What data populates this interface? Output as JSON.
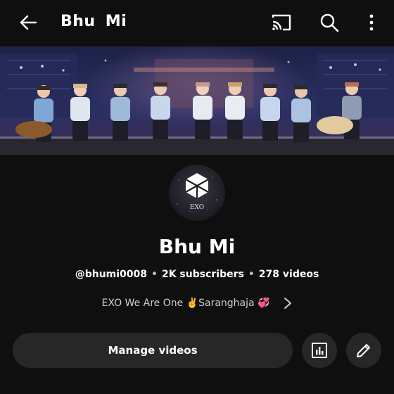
{
  "header": {
    "title": "Bhu  Mi",
    "icons": [
      "back-arrow-icon",
      "cast-icon",
      "search-icon",
      "more-vert-icon"
    ]
  },
  "channel": {
    "name": "Bhu Mi",
    "handle": "@bhumi0008",
    "subscribers": "2K subscribers",
    "videos": "278 videos",
    "description": "EXO We Are One ✌️Saranghaja 💞",
    "avatar_text": "EXO"
  },
  "actions": {
    "manage_label": "Manage videos"
  },
  "colors": {
    "background": "#0f0f0f",
    "button_bg": "#272727",
    "text": "#ffffff"
  }
}
